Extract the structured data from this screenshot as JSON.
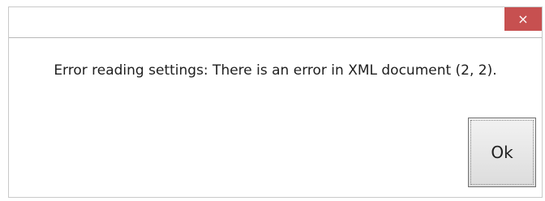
{
  "dialog": {
    "close_label": "×",
    "message": "Error reading settings: There is an error in XML document (2, 2).",
    "ok_label": "Ok"
  },
  "colors": {
    "close_button_bg": "#c75050",
    "border": "#c9c9c9"
  }
}
